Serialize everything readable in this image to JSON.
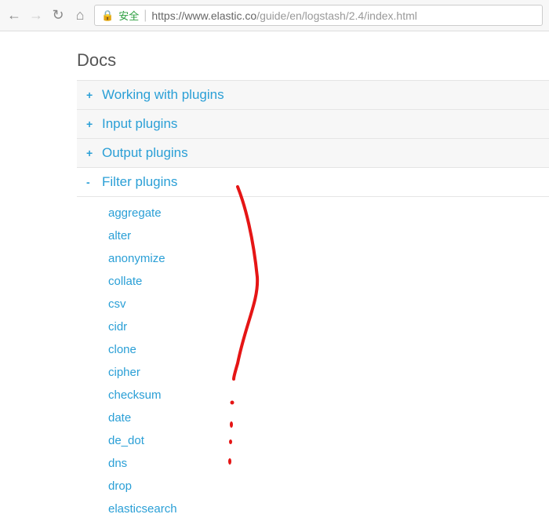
{
  "browser": {
    "secure_label": "安全",
    "url_host": "https://www.elastic.co",
    "url_path": "/guide/en/logstash/2.4/index.html"
  },
  "header": {
    "title": "Docs"
  },
  "accordion": [
    {
      "label": "Working with plugins",
      "expanded": false
    },
    {
      "label": "Input plugins",
      "expanded": false
    },
    {
      "label": "Output plugins",
      "expanded": false
    },
    {
      "label": "Filter plugins",
      "expanded": true
    }
  ],
  "filter_plugins": [
    "aggregate",
    "alter",
    "anonymize",
    "collate",
    "csv",
    "cidr",
    "clone",
    "cipher",
    "checksum",
    "date",
    "de_dot",
    "dns",
    "drop",
    "elasticsearch"
  ]
}
